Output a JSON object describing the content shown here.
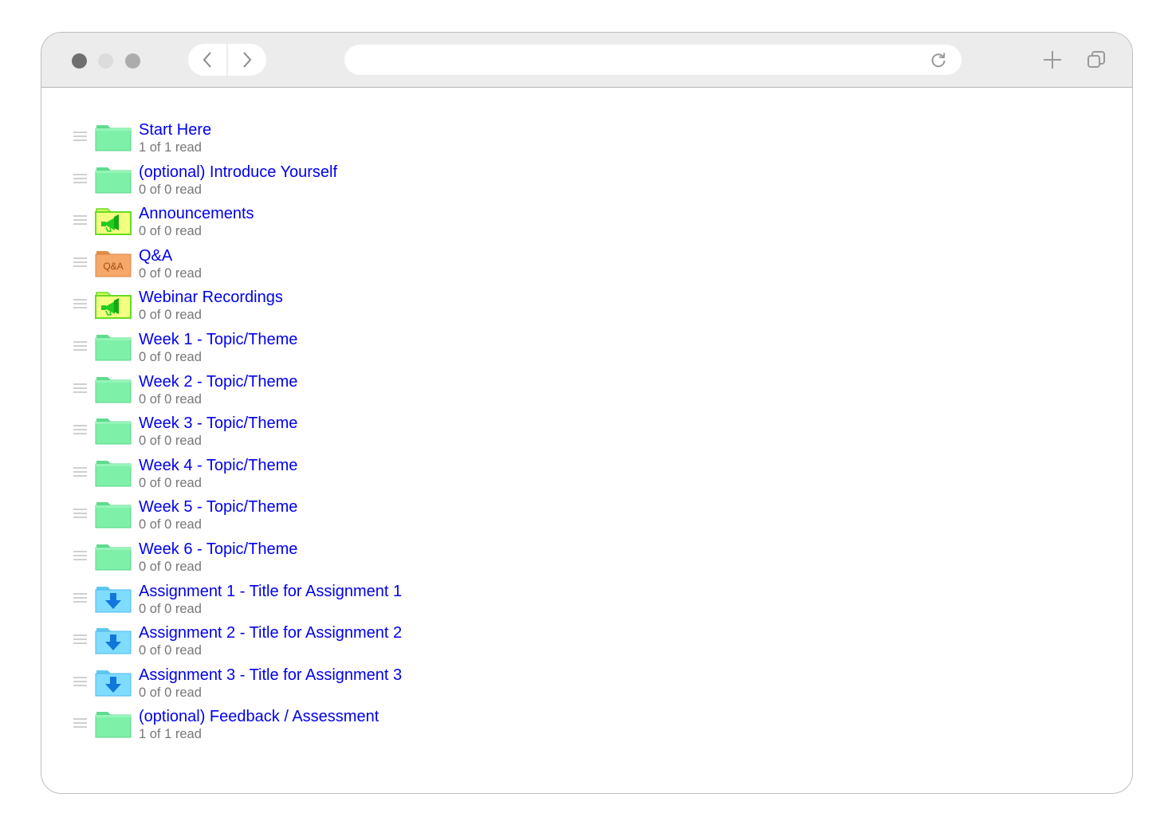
{
  "browser": {
    "window_controls": [
      "close",
      "minimize",
      "maximize"
    ],
    "back_icon": "chevron-left-icon",
    "forward_icon": "chevron-right-icon",
    "address_bar": {
      "value": "",
      "placeholder": ""
    },
    "reload_icon": "reload-icon",
    "new_tab_icon": "plus-icon",
    "tabs_icon": "tabs-overview-icon"
  },
  "colors": {
    "link": "#0000ee",
    "meta": "#777777",
    "folder_green": "#7ff0a8",
    "folder_yellow": "#f2ff80",
    "folder_orange": "#f6a76a",
    "folder_blue": "#7fdcff"
  },
  "forums": [
    {
      "title": "Start Here",
      "status": "1 of 1 read",
      "icon": "green-folder-icon"
    },
    {
      "title": "(optional) Introduce Yourself",
      "status": "0 of 0 read",
      "icon": "green-folder-icon"
    },
    {
      "title": "Announcements",
      "status": "0 of 0 read",
      "icon": "megaphone-folder-icon"
    },
    {
      "title": "Q&A",
      "status": "0 of 0 read",
      "icon": "qa-folder-icon",
      "icon_label": "Q&A"
    },
    {
      "title": "Webinar Recordings",
      "status": "0 of 0 read",
      "icon": "megaphone-folder-icon"
    },
    {
      "title": "Week 1 - Topic/Theme",
      "status": "0 of 0 read",
      "icon": "green-folder-icon"
    },
    {
      "title": "Week 2 - Topic/Theme",
      "status": "0 of 0 read",
      "icon": "green-folder-icon"
    },
    {
      "title": "Week 3 - Topic/Theme",
      "status": "0 of 0 read",
      "icon": "green-folder-icon"
    },
    {
      "title": "Week 4 - Topic/Theme",
      "status": "0 of 0 read",
      "icon": "green-folder-icon"
    },
    {
      "title": "Week 5 - Topic/Theme",
      "status": "0 of 0 read",
      "icon": "green-folder-icon"
    },
    {
      "title": "Week 6 - Topic/Theme",
      "status": "0 of 0 read",
      "icon": "green-folder-icon"
    },
    {
      "title": "Assignment 1 - Title for Assignment 1",
      "status": "0 of 0 read",
      "icon": "dropbox-folder-icon"
    },
    {
      "title": "Assignment 2 - Title for Assignment 2",
      "status": "0 of 0 read",
      "icon": "dropbox-folder-icon"
    },
    {
      "title": "Assignment 3 - Title for Assignment 3",
      "status": "0 of 0 read",
      "icon": "dropbox-folder-icon"
    },
    {
      "title": "(optional) Feedback / Assessment",
      "status": "1 of 1 read",
      "icon": "green-folder-icon"
    }
  ]
}
